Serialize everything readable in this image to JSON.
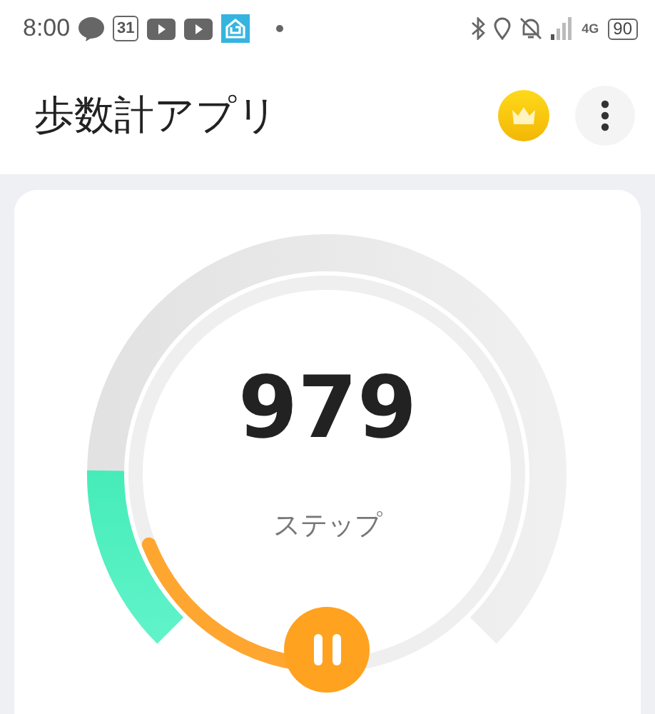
{
  "status_bar": {
    "time": "8:00",
    "calendar_day": "31",
    "network": "4G",
    "battery": "90"
  },
  "header": {
    "title": "歩数計アプリ"
  },
  "counter": {
    "steps": "979",
    "unit": "ステップ"
  }
}
